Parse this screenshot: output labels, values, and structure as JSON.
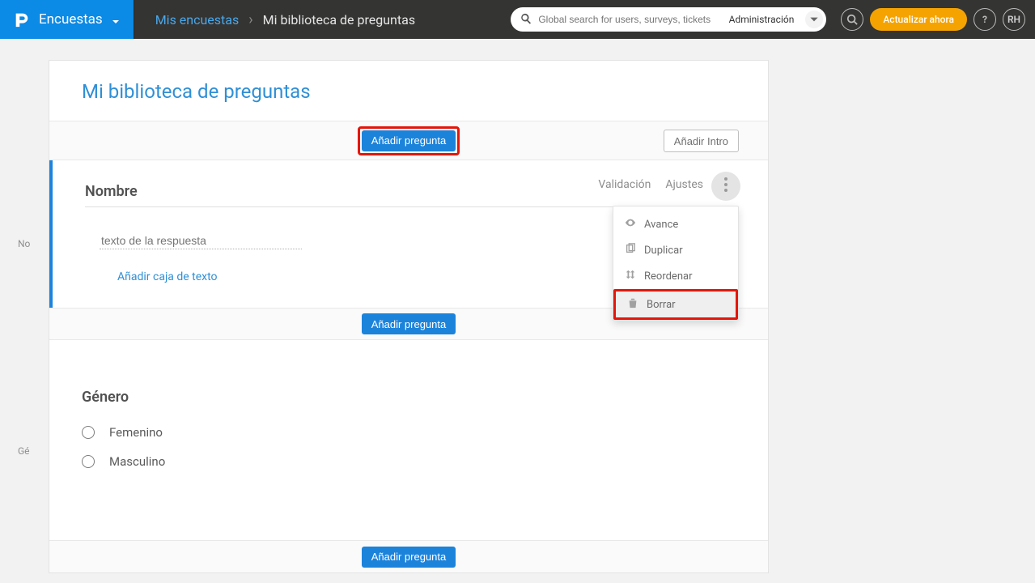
{
  "header": {
    "brand": "Encuestas",
    "breadcrumb_link": "Mis encuestas",
    "breadcrumb_current": "Mi biblioteca de preguntas",
    "search_placeholder": "Global search for users, surveys, tickets",
    "admin_label": "Administración",
    "upgrade_label": "Actualizar ahora",
    "user_initials": "RH"
  },
  "page": {
    "title": "Mi biblioteca de preguntas",
    "add_question_label": "Añadir pregunta",
    "add_intro_label": "Añadir Intro"
  },
  "side": {
    "q1_tag": "No",
    "q2_tag": "Gé"
  },
  "q1": {
    "tabs": {
      "validation": "Validación",
      "settings": "Ajustes"
    },
    "title": "Nombre",
    "answer_placeholder": "texto de la respuesta",
    "add_textbox": "Añadir caja de texto"
  },
  "menu": {
    "preview": "Avance",
    "duplicate": "Duplicar",
    "reorder": "Reordenar",
    "delete": "Borrar"
  },
  "q2": {
    "title": "Género",
    "opt1": "Femenino",
    "opt2": "Masculino"
  }
}
